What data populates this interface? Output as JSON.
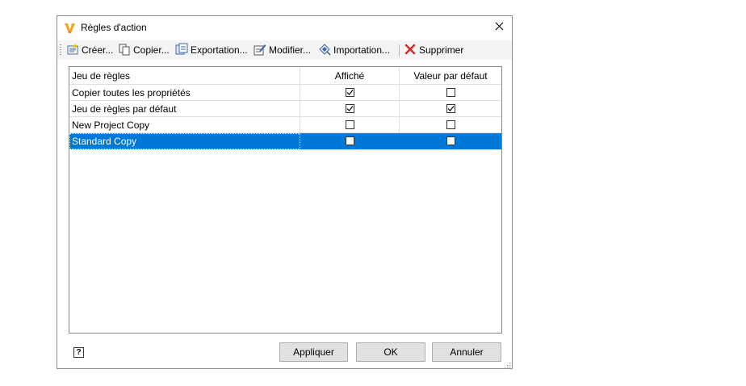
{
  "window": {
    "title": "Règles d'action",
    "icon": "vault-app-icon",
    "close_icon": "close-icon"
  },
  "toolbar": {
    "items": [
      {
        "label": "Créer...",
        "icon": "create-icon"
      },
      {
        "label": "Copier...",
        "icon": "copy-icon"
      },
      {
        "label": "Exportation...",
        "icon": "export-icon"
      },
      {
        "label": "Modifier...",
        "icon": "edit-icon"
      },
      {
        "label": "Importation...",
        "icon": "import-icon"
      },
      {
        "label": "Supprimer",
        "icon": "delete-icon"
      }
    ]
  },
  "table": {
    "columns": [
      "Jeu de règles",
      "Affiché",
      "Valeur par défaut"
    ],
    "rows": [
      {
        "name": "Copier toutes les propriétés",
        "affiche": true,
        "defaut": false,
        "selected": false
      },
      {
        "name": "Jeu de règles par défaut",
        "affiche": true,
        "defaut": true,
        "selected": false
      },
      {
        "name": "New Project Copy",
        "affiche": false,
        "defaut": false,
        "selected": false
      },
      {
        "name": "Standard Copy",
        "affiche": false,
        "defaut": false,
        "selected": true
      }
    ]
  },
  "footer": {
    "help_label": "?",
    "apply_label": "Appliquer",
    "ok_label": "OK",
    "cancel_label": "Annuler"
  },
  "colors": {
    "selection": "#0078d7",
    "button_face": "#e1e1e1",
    "accent_logo": "#f5a623"
  }
}
